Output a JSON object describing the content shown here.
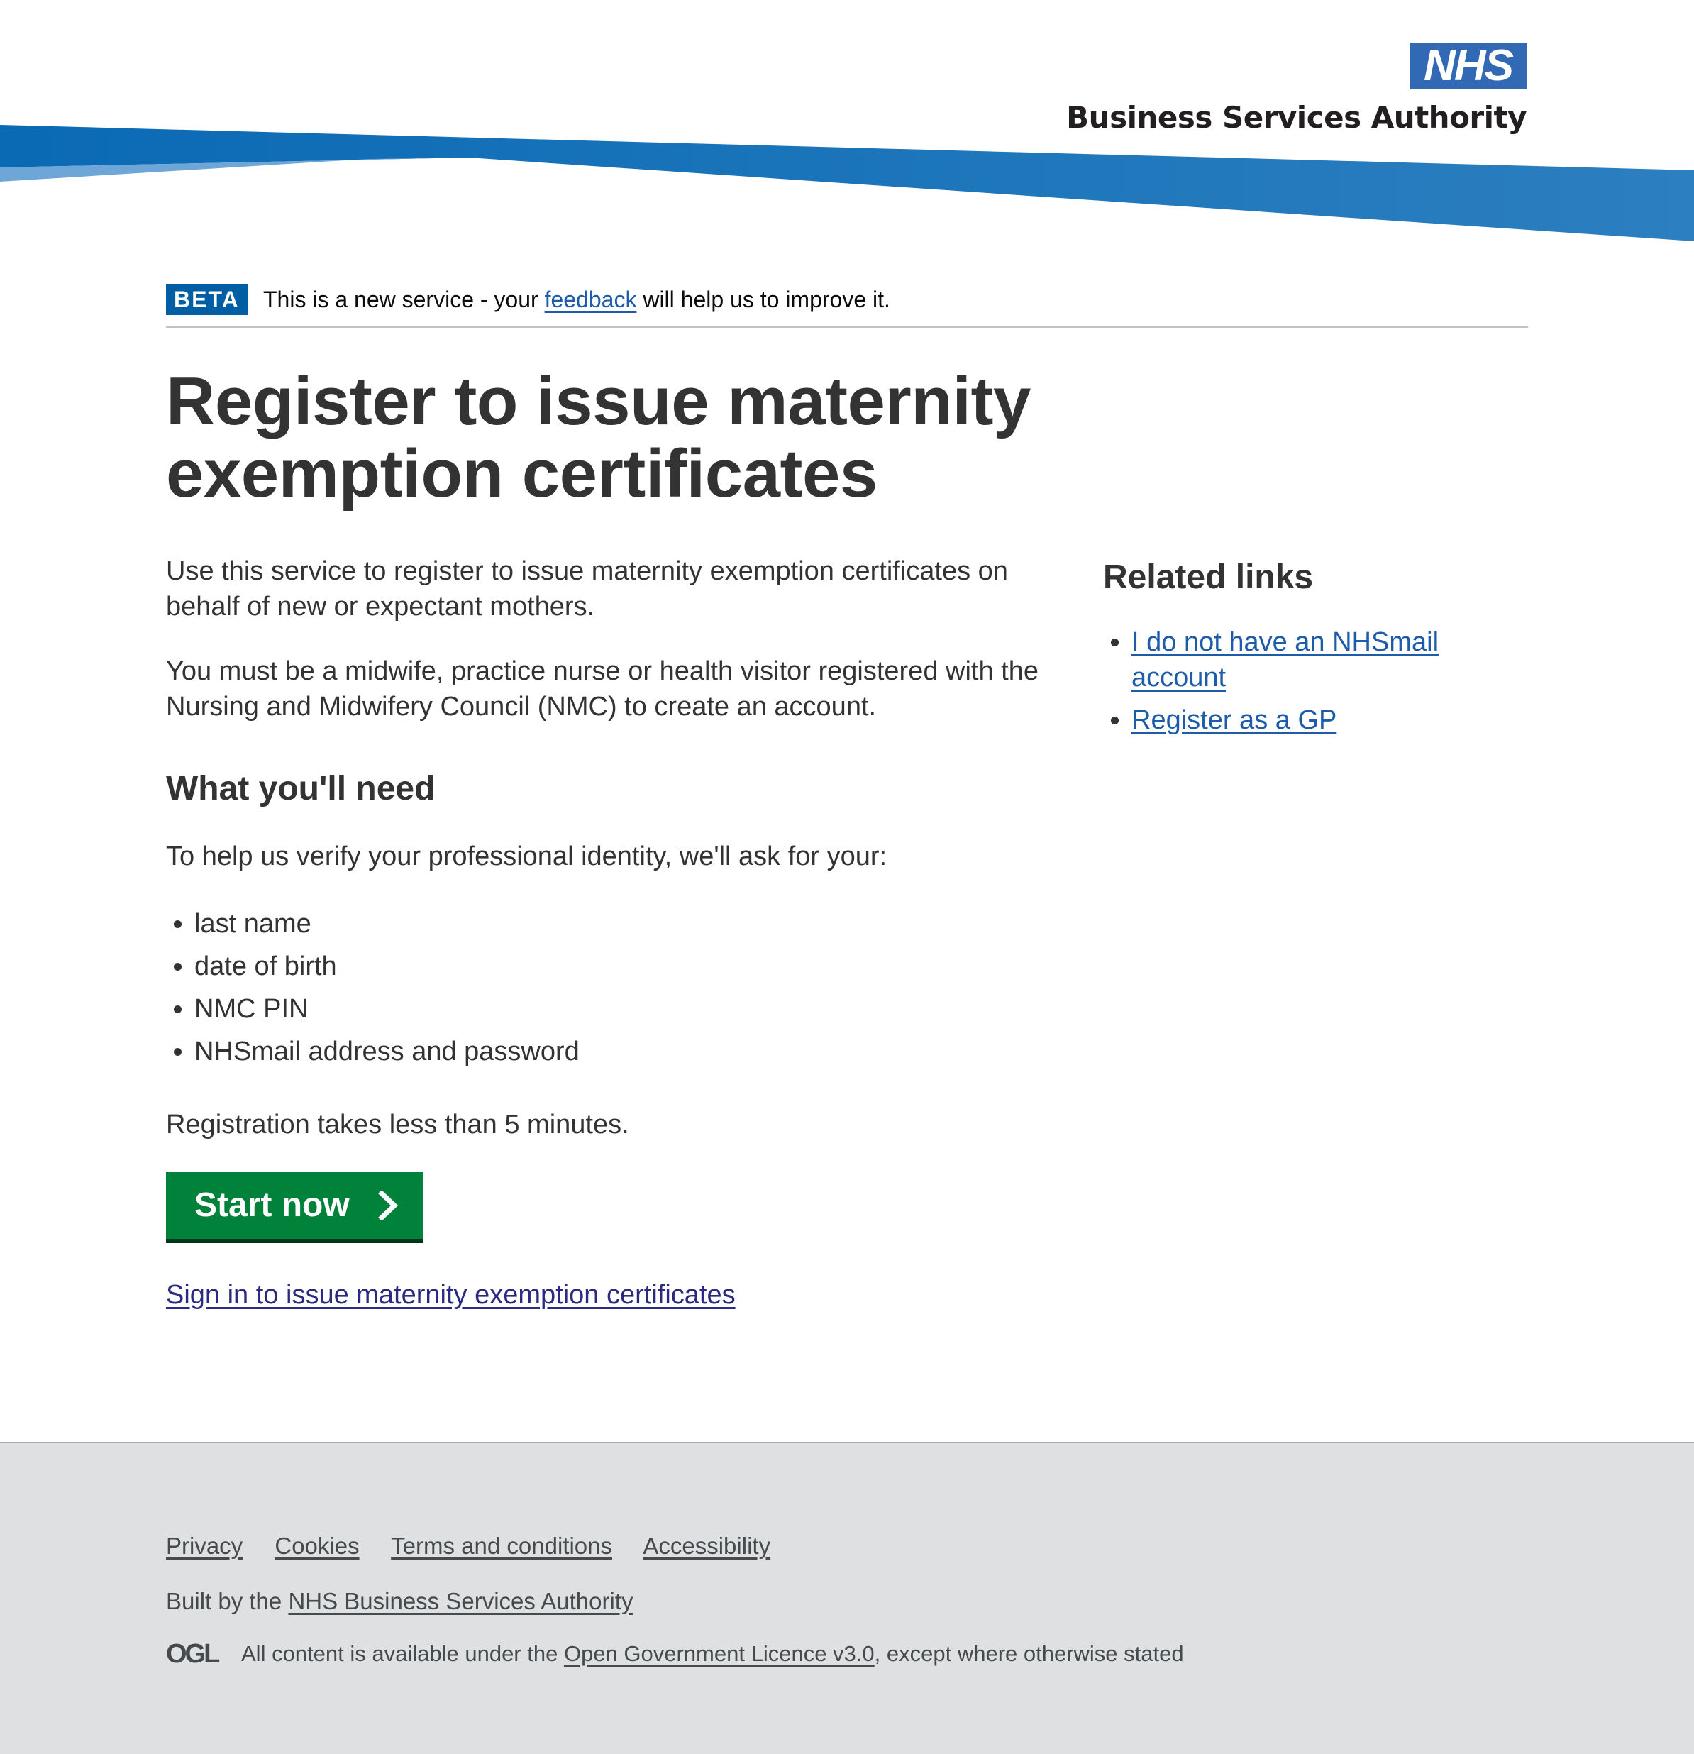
{
  "header": {
    "logo_text": "NHS",
    "org_name": "Business Services Authority",
    "brand_color": "#005eb8"
  },
  "beta": {
    "tag": "BETA",
    "text_before": "This is a new service - your ",
    "link": "feedback",
    "text_after": " will help us to improve it."
  },
  "main": {
    "title": "Register to issue maternity exemption certificates",
    "intro": "Use this service to register to issue maternity exemption certificates on behalf of new or expectant mothers.",
    "eligibility": "You must be a midwife, practice nurse or health visitor registered with the Nursing and Midwifery Council (NMC) to create an account.",
    "need_heading": "What you'll need",
    "need_intro": "To help us verify your professional identity, we'll ask for your:",
    "needs": [
      "last name",
      "date of birth",
      "NMC PIN",
      "NHSmail address and password"
    ],
    "duration": "Registration takes less than 5 minutes.",
    "start_button": "Start now",
    "signin_link": "Sign in to issue maternity exemption certificates"
  },
  "related": {
    "heading": "Related links",
    "links": [
      "I do not have an NHSmail account",
      "Register as a GP"
    ]
  },
  "footer": {
    "links": [
      "Privacy",
      "Cookies",
      "Terms and conditions",
      "Accessibility"
    ],
    "built_by_prefix": "Built by the ",
    "built_by_link": "NHS Business Services Authority",
    "ogl_logo": "OGL",
    "licence_prefix": "All content is available under the ",
    "licence_link": "Open Government Licence v3.0",
    "licence_suffix": ", except where otherwise stated"
  },
  "colors": {
    "start_button": "#00823b",
    "beta_tag": "#005ea5",
    "footer_bg": "#dee0e2"
  }
}
